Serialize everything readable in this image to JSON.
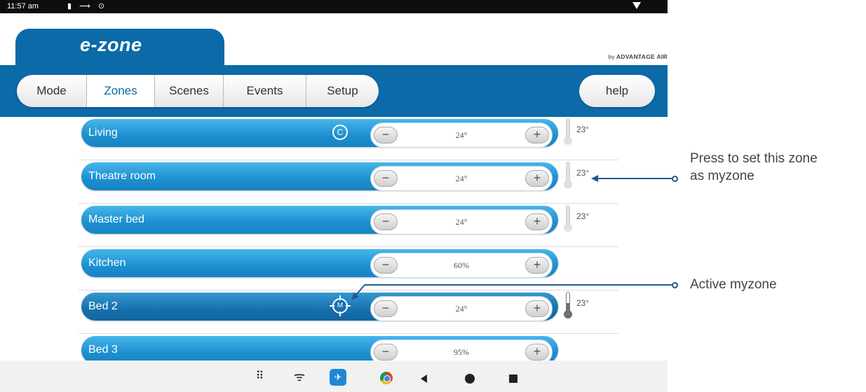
{
  "status_bar": {
    "time": "11:57 am",
    "icons": [
      "sim-icon",
      "charging-icon",
      "clock-icon",
      "wifi-icon"
    ]
  },
  "app": {
    "logo": "e-zone",
    "brand_prefix": "by",
    "brand_name": "ADVANTAGE AIR"
  },
  "tabs": [
    {
      "label": "Mode",
      "active": false
    },
    {
      "label": "Zones",
      "active": true
    },
    {
      "label": "Scenes",
      "active": false
    },
    {
      "label": "Events",
      "active": false
    },
    {
      "label": "Setup",
      "active": false
    }
  ],
  "help_label": "help",
  "zones": [
    {
      "name": "Living",
      "badge": "C",
      "setpoint": "24°",
      "temperature": "23°",
      "myzone": false
    },
    {
      "name": "Theatre room",
      "badge": "",
      "setpoint": "24°",
      "temperature": "23°",
      "myzone": false
    },
    {
      "name": "Master bed",
      "badge": "",
      "setpoint": "24°",
      "temperature": "23°",
      "myzone": false
    },
    {
      "name": "Kitchen",
      "badge": "",
      "setpoint": "60%",
      "temperature": "",
      "myzone": false
    },
    {
      "name": "Bed 2",
      "badge": "M",
      "setpoint": "24°",
      "temperature": "23°",
      "myzone": true
    },
    {
      "name": "Bed 3",
      "badge": "",
      "setpoint": "95%",
      "temperature": "",
      "myzone": false
    }
  ],
  "stepper": {
    "minus": "−",
    "plus": "+"
  },
  "callouts": {
    "set_myzone_line1": "Press to set this zone",
    "set_myzone_line2": "as myzone",
    "active_myzone": "Active myzone"
  },
  "colors": {
    "brand_blue": "#0b6aa7",
    "zone_blue": "#1d8fcf",
    "callout_line": "#1f5a91"
  }
}
